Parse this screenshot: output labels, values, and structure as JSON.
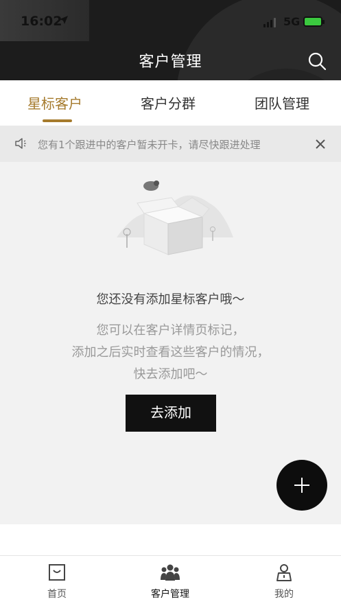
{
  "status_bar": {
    "time": "16:02",
    "network": "5G"
  },
  "header": {
    "title": "客户管理"
  },
  "tabs": [
    {
      "label": "星标客户"
    },
    {
      "label": "客户分群"
    },
    {
      "label": "团队管理"
    }
  ],
  "notice": {
    "text": "您有1个跟进中的客户暂未开卡，请尽快跟进处理"
  },
  "empty_state": {
    "title": "您还没有添加星标客户哦～",
    "desc_line1": "您可以在客户详情页标记，",
    "desc_line2": "添加之后实时查看这些客户的情况，",
    "desc_line3": "快去添加吧～",
    "button": "去添加"
  },
  "tabbar": [
    {
      "label": "首页",
      "icon": "home-bag-icon"
    },
    {
      "label": "客户管理",
      "icon": "customers-icon"
    },
    {
      "label": "我的",
      "icon": "profile-icon"
    }
  ],
  "colors": {
    "accent": "#a57a2c",
    "header_bg": "#1c1c1c",
    "button_bg": "#111111"
  }
}
